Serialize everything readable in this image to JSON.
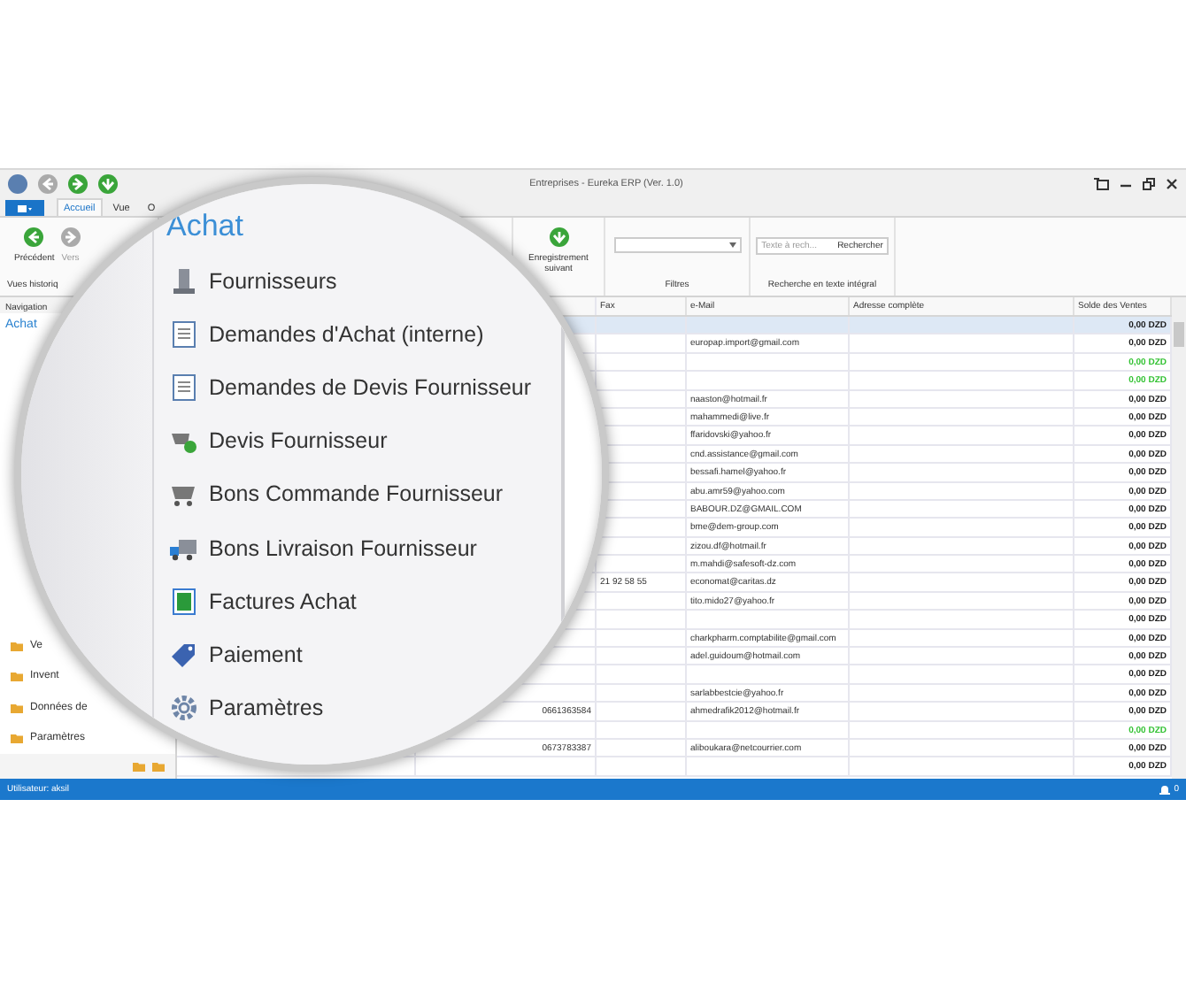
{
  "window": {
    "title": "Entreprises - Eureka ERP (Ver. 1.0)"
  },
  "ribbon_tabs": [
    {
      "label": "Accueil",
      "selected": true
    },
    {
      "label": "Vue",
      "selected": false
    },
    {
      "label": "O",
      "selected": false
    }
  ],
  "history_group": {
    "label": "Vues historiq",
    "buttons": [
      {
        "label": "Précédent",
        "disabled": false
      },
      {
        "label": "Vers",
        "disabled": true
      }
    ]
  },
  "record_button": {
    "label": "Enregistrement suivant"
  },
  "filters_group": {
    "label": "Filtres"
  },
  "search_group": {
    "label": "Recherche en texte intégral",
    "placeholder": "Texte à rech...",
    "button": "Rechercher"
  },
  "navigation": {
    "title": "Navigation",
    "section": "Achat",
    "folders": [
      "Ve",
      "Invent",
      "Données de",
      "Paramètres"
    ]
  },
  "table": {
    "columns": [
      "Fax",
      "e-Mail",
      "Adresse complète",
      "Solde des Ventes"
    ],
    "rows": [
      {
        "balance": "0,00 DZD",
        "color": "#1a1a1a",
        "selected": true
      },
      {
        "email": "europap.import@gmail.com",
        "balance": "0,00 DZD",
        "color": "#1a1a1a",
        "selected": false
      },
      {
        "balance": "0,00 DZD",
        "color": "#33c233",
        "selected": false
      },
      {
        "balance": "0,00 DZD",
        "color": "#33c233",
        "selected": false
      },
      {
        "email": "naaston@hotmail.fr",
        "balance": "0,00 DZD",
        "color": "#1a1a1a",
        "selected": false
      },
      {
        "email": "mahammedi@live.fr",
        "balance": "0,00 DZD",
        "color": "#1a1a1a",
        "selected": false
      },
      {
        "email": "ffaridovski@yahoo.fr",
        "balance": "0,00 DZD",
        "color": "#1a1a1a",
        "selected": false
      },
      {
        "email": "cnd.assistance@gmail.com",
        "balance": "0,00 DZD",
        "color": "#1a1a1a",
        "selected": false
      },
      {
        "email": "bessafi.hamel@yahoo.fr",
        "balance": "0,00 DZD",
        "color": "#1a1a1a",
        "selected": false
      },
      {
        "email": "abu.amr59@yahoo.com",
        "balance": "0,00 DZD",
        "color": "#1a1a1a",
        "selected": false
      },
      {
        "email": "BABOUR.DZ@GMAIL.COM",
        "balance": "0,00 DZD",
        "color": "#1a1a1a",
        "selected": false
      },
      {
        "email": "bme@dem-group.com",
        "balance": "0,00 DZD",
        "color": "#1a1a1a",
        "selected": false
      },
      {
        "email": "zizou.df@hotmail.fr",
        "balance": "0,00 DZD",
        "color": "#1a1a1a",
        "selected": false
      },
      {
        "email": "m.mahdi@safesoft-dz.com",
        "balance": "0,00 DZD",
        "color": "#1a1a1a",
        "selected": false
      },
      {
        "fax": "21 92 58 55",
        "email": "economat@caritas.dz",
        "balance": "0,00 DZD",
        "color": "#1a1a1a",
        "selected": false
      },
      {
        "email": "tito.mido27@yahoo.fr",
        "balance": "0,00 DZD",
        "color": "#1a1a1a",
        "selected": false
      },
      {
        "balance": "0,00 DZD",
        "color": "#1a1a1a",
        "selected": false
      },
      {
        "email": "charkpharm.comptabilite@gmail.com",
        "balance": "0,00 DZD",
        "color": "#1a1a1a",
        "selected": false
      },
      {
        "email": "adel.guidoum@hotmail.com",
        "balance": "0,00 DZD",
        "color": "#1a1a1a",
        "selected": false
      },
      {
        "balance": "0,00 DZD",
        "color": "#1a1a1a",
        "selected": false
      },
      {
        "email": "sarlabbestcie@yahoo.fr",
        "balance": "0,00 DZD",
        "color": "#1a1a1a",
        "selected": false
      },
      {
        "phone": "0661363584",
        "email": "ahmedrafik2012@hotmail.fr",
        "balance": "0,00 DZD",
        "color": "#1a1a1a",
        "selected": false
      },
      {
        "balance": "0,00 DZD",
        "color": "#33c233",
        "selected": false
      },
      {
        "phone": "0673783387",
        "email": "aliboukara@netcourrier.com",
        "balance": "0,00 DZD",
        "color": "#1a1a1a",
        "selected": false
      },
      {
        "balance": "0,00 DZD",
        "color": "#1a1a1a",
        "selected": false
      }
    ]
  },
  "status_bar": {
    "user": "Utilisateur: aksil",
    "notifications": "0"
  },
  "lens": {
    "title": "Achat",
    "items": [
      {
        "label": "Fournisseurs",
        "kind": "supplier"
      },
      {
        "label": "Demandes d'Achat (interne)",
        "kind": "document"
      },
      {
        "label": "Demandes de Devis Fournisseur",
        "kind": "document"
      },
      {
        "label": "Devis Fournisseur",
        "kind": "quote"
      },
      {
        "label": "Bons Commande Fournisseur",
        "kind": "order"
      },
      {
        "label": "Bons Livraison Fournisseur",
        "kind": "delivery"
      },
      {
        "label": "Factures Achat",
        "kind": "invoice"
      },
      {
        "label": "Paiement",
        "kind": "payment"
      },
      {
        "label": "Paramètres",
        "kind": "settings"
      }
    ]
  }
}
